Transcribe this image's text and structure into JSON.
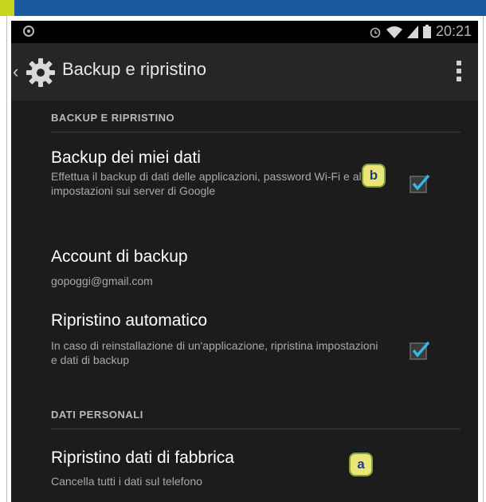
{
  "status": {
    "time": "20:21"
  },
  "actionbar": {
    "title": "Backup e ripristino"
  },
  "sections": {
    "backup": "BACKUP E RIPRISTINO",
    "personal": "DATI PERSONALI"
  },
  "items": {
    "backup_data": {
      "title": "Backup dei miei dati",
      "summary": "Effettua il backup di dati delle applicazioni, password Wi-Fi e altre impostazioni sui server di Google",
      "checked": true
    },
    "backup_account": {
      "title": "Account di backup",
      "summary": "gopoggi@gmail.com"
    },
    "auto_restore": {
      "title": "Ripristino automatico",
      "summary": "In caso di reinstallazione di un'applicazione, ripristina impostazioni e dati di backup",
      "checked": true
    },
    "factory_reset": {
      "title": "Ripristino dati di fabbrica",
      "summary": "Cancella tutti i dati sul telefono"
    }
  },
  "callouts": {
    "a": "a",
    "b": "b"
  },
  "colors": {
    "accent_check": "#33b5e5",
    "banner_blue": "#1a5a9e",
    "banner_green": "#c6d41c",
    "badge_fill": "#ece57a"
  }
}
